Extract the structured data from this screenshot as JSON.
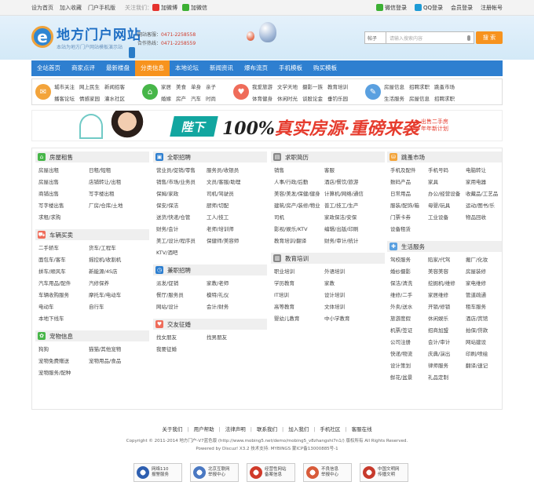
{
  "topbar": {
    "left": [
      "设为首页",
      "加入收藏",
      "门户手机版"
    ],
    "follow_label": "关注我们：",
    "weibo": "加微博",
    "weixin": "加微信",
    "right": [
      "微信登录",
      "QQ登录",
      "会员登录",
      "注册帐号"
    ]
  },
  "header": {
    "logo_title": "地方门户网站",
    "logo_sub": "本站为地方门户网站模板演示站",
    "hotline_label": "网站客服：",
    "hotline": "0471-2258558",
    "coop_label": "合作热线：",
    "coop": "0471-2258559",
    "search_select": "帖子",
    "search_placeholder": "请输入搜索内容",
    "search_button": "搜 索"
  },
  "nav": [
    "全站首页",
    "商家点评",
    "最新楼盘",
    "分类信息",
    "本地论坛",
    "新闻资讯",
    "爆布流页",
    "手机模板",
    "购买模板"
  ],
  "nav_active": "分类信息",
  "cats": [
    {
      "icon": "chat-icon",
      "color": "#f3a43b",
      "links": [
        "城市关注",
        "网上民生",
        "新闻招客",
        "播客论坛",
        "情感家园",
        "灌水社区"
      ]
    },
    {
      "icon": "home-icon",
      "color": "#47b649",
      "links": [
        "家居",
        "美食",
        "单身",
        "亲子",
        "婚嫁",
        "房产",
        "汽车",
        "时尚"
      ]
    },
    {
      "icon": "heart-icon",
      "color": "#ef6c5a",
      "links": [
        "我爱旅游",
        "文学天地",
        "摄影一族",
        "教育培训",
        "体育健身",
        "休闲时光",
        "谈股论金",
        "垂钓乐园"
      ]
    },
    {
      "icon": "tag-icon",
      "color": "#5aa0e0",
      "links": [
        "房屋信息",
        "招聘求职",
        "跳蚤市场",
        "生活服务",
        "房屋信息",
        "招聘求职"
      ]
    }
  ],
  "banner": {
    "arrow": "陛下",
    "main_black": "100%",
    "main_red": "真实房源·重磅来袭",
    "sub1": "出售二手房",
    "sub2": "年年新计划"
  },
  "sections": {
    "col1": [
      {
        "title": "房屋租售",
        "color": "#47b649",
        "icon": "house-icon",
        "layout": "l2",
        "links": [
          "房屋出租",
          "日租/短租",
          "房屋出售",
          "店铺转让/出租",
          "商铺出售",
          "写字楼出租",
          "写字楼出售",
          "厂房/仓库/土地",
          "求租/求购"
        ]
      },
      {
        "title": "车辆买卖",
        "color": "#ef6c5a",
        "icon": "car-icon",
        "layout": "l2",
        "links": [
          "二手轿车",
          "货车/工程车",
          "面包车/客车",
          "摇控机/收割机",
          "拼车/顺风车",
          "新能源/4S店",
          "汽车用品/配件",
          "汽修保养",
          "车辆收购服务",
          "摩托车/电动车",
          "电动车",
          "自行车",
          "本地下线车"
        ]
      },
      {
        "title": "宠物信息",
        "color": "#47b649",
        "icon": "paw-icon",
        "layout": "l2",
        "links": [
          "狗狗",
          "猫猫/其他宠物",
          "宠物免费赠送",
          "宠物用品/食品",
          "宠物服务/配种"
        ]
      }
    ],
    "col2": [
      {
        "title": "全职招聘",
        "color": "#2e7fd0",
        "icon": "briefcase-icon",
        "layout": "l2",
        "links": [
          "营业员/促销/零售",
          "服务员/收银员",
          "销售/市场/业务员",
          "文员/客服/助理",
          "保姆/家政",
          "司机/驾驶员",
          "保安/保洁",
          "厨师/切配",
          "送货/快递/仓管",
          "工人/技工",
          "财务/会计",
          "老师/培训师",
          "美工/设计/程序员",
          "保健师/美容师",
          "KTV/酒吧"
        ]
      },
      {
        "title": "兼职招聘",
        "color": "#2e7fd0",
        "icon": "clock-icon",
        "layout": "l2",
        "links": [
          "派发/促销",
          "家教/老师",
          "餐厅/服务员",
          "模特/礼仪",
          "网站/设计",
          "会计/财务"
        ]
      },
      {
        "title": "交友征婚",
        "color": "#ef6c5a",
        "icon": "heart-icon",
        "layout": "l2",
        "links": [
          "找女朋友",
          "找男朋友",
          "我要征婚"
        ]
      }
    ],
    "col3": [
      {
        "title": "求职简历",
        "color": "#888888",
        "icon": "doc-icon",
        "layout": "l2",
        "links": [
          "销售",
          "客服",
          "人事/行政/后勤",
          "酒店/餐饮/旅游",
          "美容/美发/保健/健身",
          "计算机/网络/通信",
          "建筑/房产/装修/物业",
          "普工/技工/生产",
          "司机",
          "家政保洁/安保",
          "影视/娱乐/KTV",
          "编辑/出版/印刷",
          "教育培训/翻译",
          "财务/审计/统计"
        ]
      },
      {
        "title": "教育培训",
        "color": "#888888",
        "icon": "book-icon",
        "layout": "l2",
        "links": [
          "职业培训",
          "外语培训",
          "学历教育",
          "家教",
          "IT培训",
          "设计培训",
          "高等教育",
          "文体培训",
          "婴幼儿教育",
          "中小学教育"
        ]
      }
    ],
    "col4": [
      {
        "title": "跳蚤市场",
        "color": "#f3a43b",
        "icon": "cart-icon",
        "layout": "l3",
        "links": [
          "手机及配件",
          "手机号码",
          "电脑转让",
          "数码产品",
          "家具",
          "家用电器",
          "日常用品",
          "办公/经营设备",
          "收藏品/工艺品",
          "服装/配饰/箱",
          "母婴/玩具",
          "运动/图书/乐",
          "门票卡券",
          "工业设备",
          "物品回收",
          "设备租赁"
        ]
      },
      {
        "title": "生活服务",
        "color": "#5aa0e0",
        "icon": "wrench-icon",
        "layout": "l3",
        "links": [
          "驾校服务",
          "陷家/代驾",
          "搬厂/化妆",
          "婚纱摄影",
          "美容美容",
          "房屋装修",
          "保洁/清洗",
          "挖掘机/维修",
          "家电维修",
          "维修/二手",
          "家居维修",
          "管道疏通",
          "外卖/送水",
          "开锁/修锁",
          "租车服务",
          "旅游度假",
          "休闲娱乐",
          "酒店/宾馆",
          "机票/签证",
          "招商加盟",
          "拍保/贷款",
          "公司注册",
          "会计/审计",
          "网站建设",
          "快递/物流",
          "庆典/演出",
          "印刷/喷绘",
          "设计策划",
          "律师服务",
          "翻译/速记",
          "鲜花/盆景",
          "礼品定制"
        ]
      }
    ]
  },
  "footer": {
    "links": [
      "关于我们",
      "用户帮助",
      "法律声明",
      "联系我们",
      "加入我们",
      "手机社区",
      "客服在线"
    ],
    "copyright": "Copyright © 2011-2014 地方门户-V7蓝色版 (http://www.mobing5.net/demo/mobing5_v8zhangshi7n1/) 版权所有 All Rights Reserved.",
    "powered": "Powered by Discuz! X3.2 技术支持: MYBINGS 蒙ICP备13000885号-1"
  },
  "badges": [
    {
      "line1": "网络110",
      "line2": "报警服务",
      "color": "#2e5fb0"
    },
    {
      "line1": "北京互联网",
      "line2": "举报中心",
      "color": "#4a78c2"
    },
    {
      "line1": "经营性网站",
      "line2": "备案信息",
      "color": "#d03a2a"
    },
    {
      "line1": "不良信息",
      "line2": "举报中心",
      "color": "#d85b3a"
    },
    {
      "line1": "中国文明网",
      "line2": "传播文明",
      "color": "#c73a2c"
    }
  ]
}
